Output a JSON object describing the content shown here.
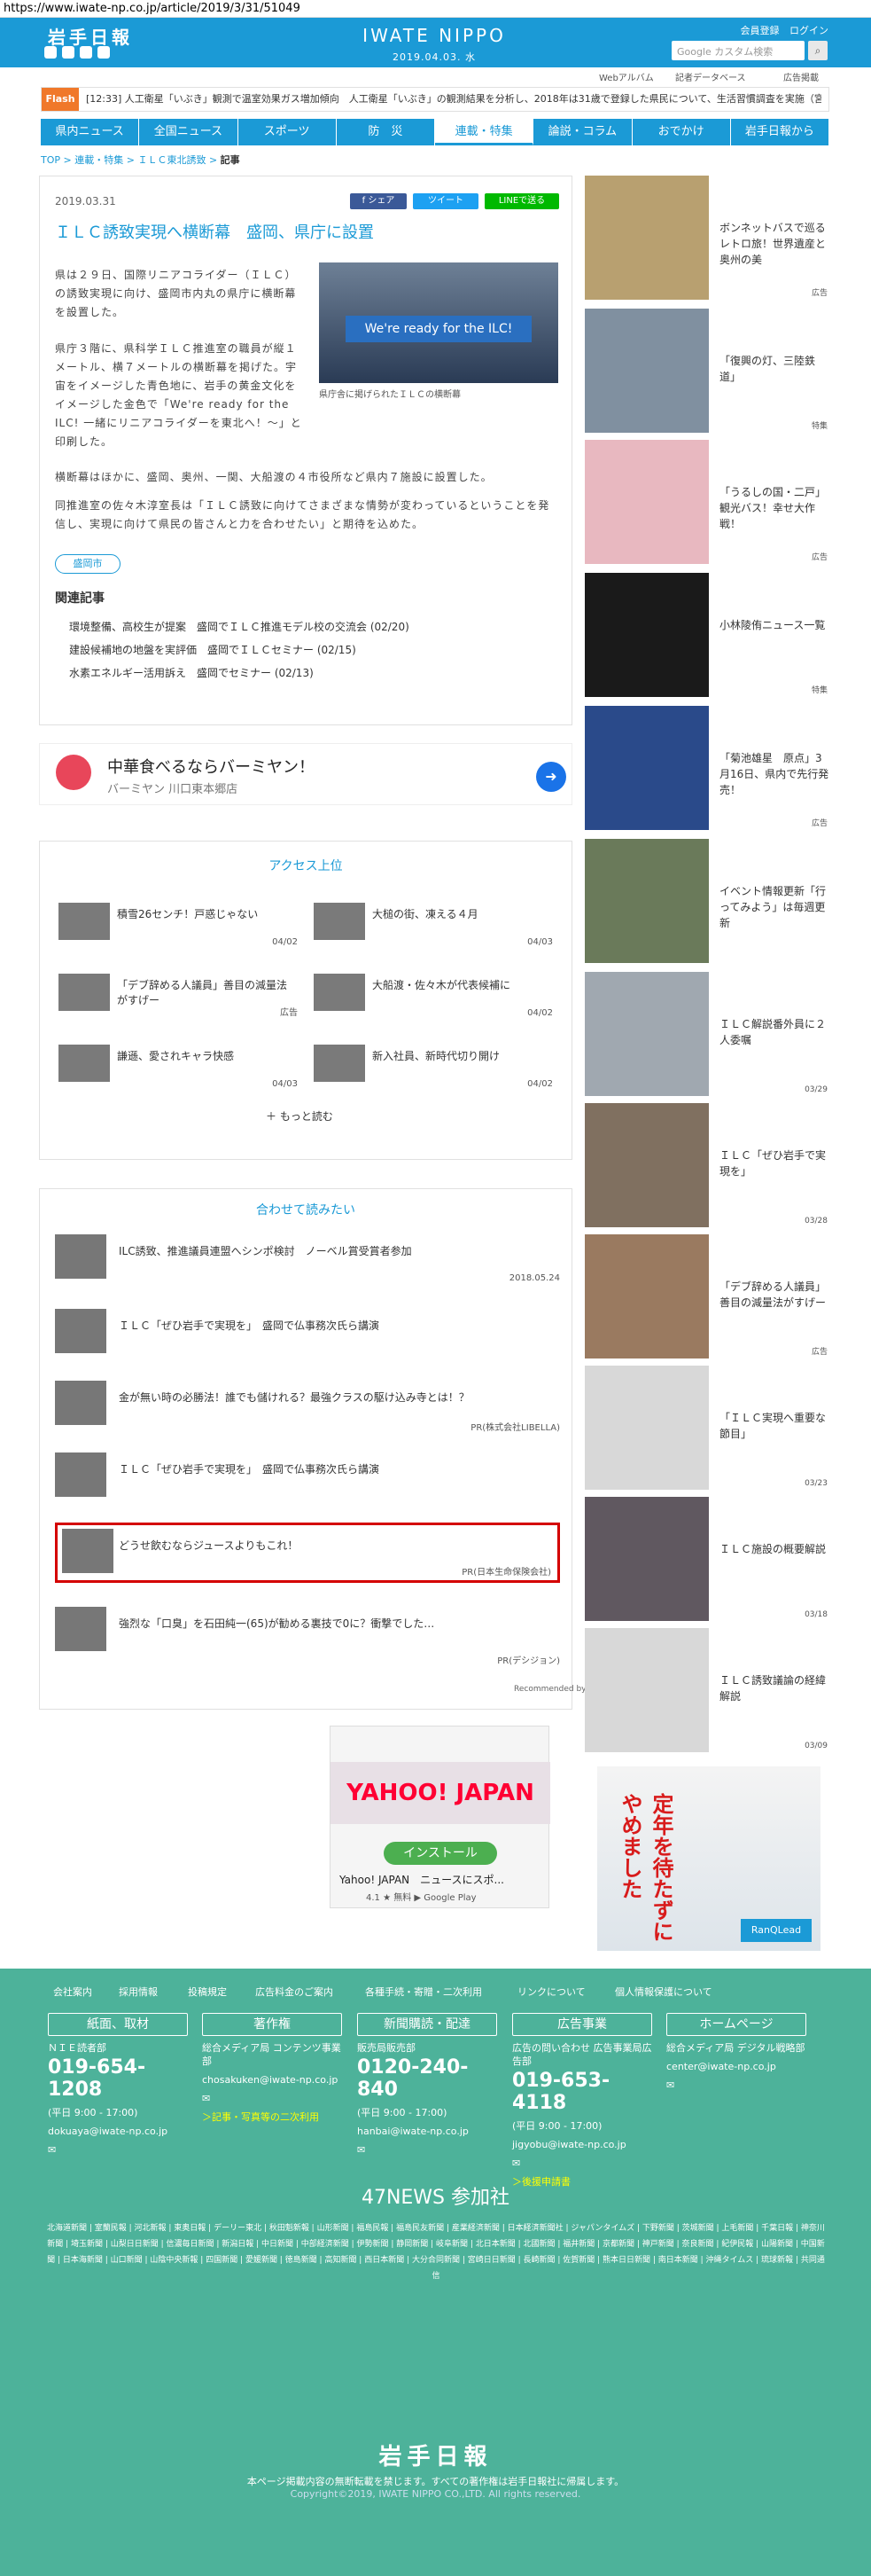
{
  "url": "https://www.iwate-np.co.jp/article/2019/3/31/51049",
  "header": {
    "logo": "岩手日報",
    "brand": "IWATE NIPPO",
    "date": "2019.04.03. 水",
    "member": "会員登録",
    "login": "ログイン",
    "search_placeholder": "Google カスタム検索"
  },
  "subnav": {
    "web_album": "Webアルバム",
    "archive": "記者データベース",
    "ads": "広告掲載"
  },
  "flash": {
    "label": "Flash",
    "text": "[12:33] 人工衛星「いぶき」観測で温室効果ガス増加傾向　人工衛星「いぶき」の観測結果を分析し、2018年は31歳で登録した県民について、生活習慣調査を実施（宮城）"
  },
  "nav": [
    "県内ニュース",
    "全国ニュース",
    "スポーツ",
    "防　災",
    "連載・特集",
    "論説・コラム",
    "おでかけ",
    "岩手日報から"
  ],
  "breadcrumb": {
    "top": "TOP",
    "sep1": " > ",
    "c1": "連載・特集",
    "sep2": " > ",
    "c2": "ＩＬＣ東北誘致",
    "sep3": " > ",
    "current": "記事"
  },
  "article": {
    "date": "2019.03.31",
    "share_fb": "f シェア",
    "share_tw": "ツイート",
    "share_line": "LINEで送る",
    "title": "ＩＬＣ誘致実現へ横断幕　盛岡、県庁に設置",
    "photo_caption": "県庁舎に掲げられたＩＬＣの横断幕",
    "p1": "県は２９日、国際リニアコライダー（ＩＬＣ）の誘致実現に向け、盛岡市内丸の県庁に横断幕を設置した。",
    "p2": "県庁３階に、県科学ＩＬＣ推進室の職員が縦１メートル、横７メートルの横断幕を掲げた。宇宙をイメージした青色地に、岩手の黄金文化をイメージした金色で「We're ready for the ILC! 一緒にリニアコライダーを東北へ！～」と印刷した。",
    "p3": "横断幕はほかに、盛岡、奥州、一関、大船渡の４市役所など県内７施設に設置した。",
    "p4": "同推進室の佐々木淳室長は「ＩＬＣ誘致に向けてさまざまな情勢が変わっているということを発信し、実現に向けて県民の皆さんと力を合わせたい」と期待を込めた。",
    "tag": "盛岡市",
    "related_heading": "関連記事",
    "related": [
      "環境整備、高校生が提案　盛岡でＩＬＣ推進モデル校の交流会 (02/20)",
      "建設候補地の地盤を実評価　盛岡でＩＬＣセミナー (02/15)",
      "水素エネルギー活用訴え　盛岡でセミナー (02/13)"
    ]
  },
  "ad1": {
    "title": "中華食べるならバーミヤン！",
    "sub": "バーミヤン 川口東本郷店"
  },
  "ranking": {
    "heading": "アクセス上位",
    "more": "もっと読む",
    "items": [
      {
        "title": "積雪26センチ！戸惑じゃない",
        "date": "04/02"
      },
      {
        "title": "大槌の街、凍える４月",
        "date": "04/03"
      },
      {
        "title": "「デブ辞める人議員」善目の減量法がすげー",
        "date": "広告"
      },
      {
        "title": "大船渡・佐々木が代表候補に",
        "date": "04/02"
      },
      {
        "title": "謙遜、愛されキャラ快感",
        "date": "04/03"
      },
      {
        "title": "新入社員、新時代切り開け",
        "date": "04/02"
      }
    ]
  },
  "recommend": {
    "heading": "合わせて読みたい",
    "credit": "Recommended by",
    "items": [
      {
        "title": "ILC誘致、推進議員連盟へシンポ検討　ノーベル賞受賞者参加",
        "date": "2018.05.24"
      },
      {
        "title": "ＩＬＣ「ぜひ岩手で実現を」　盛岡で仏事務次氏ら講演",
        "date": ""
      },
      {
        "title": "金が無い時の必勝法！誰でも儲けれる？最強クラスの駆け込み寺とは！？",
        "date": "PR(株式会社LIBELLA)"
      },
      {
        "title": "ＩＬＣ「ぜひ岩手で実現を」　盛岡で仏事務次氏ら講演",
        "date": ""
      },
      {
        "title": "どうせ飲むならジュースよりもこれ！",
        "date": "PR(日本生命保険会社)"
      },
      {
        "title": "強烈な「口臭」を石田純一(65)が勧める裏技で0に？衝撃でした…",
        "date": "PR(デシジョン)"
      }
    ]
  },
  "ad2": {
    "logo": "YAHOO! JAPAN",
    "install": "インストール",
    "name": "Yahoo! JAPAN　ニュースにスポ...",
    "rating": "4.1 ★ 無料 ▶ Google Play"
  },
  "sidebar": [
    {
      "title": "ボンネットバスで巡るレトロ旅！世界遺産と奥州の美",
      "date": "広告"
    },
    {
      "title": "「復興の灯、三陸鉄道」",
      "date": "特集"
    },
    {
      "title": "「うるしの国・二戸」観光バス！幸せ大作戦！",
      "date": "広告"
    },
    {
      "title": "小林陵侑ニュース一覧",
      "date": "特集"
    },
    {
      "title": "「菊池雄星　原点」3月16日、県内で先行発売！",
      "date": "広告"
    },
    {
      "title": "イベント情報更新「行ってみよう」は毎週更新",
      "date": ""
    },
    {
      "title": "ＩＬＣ解説番外員に２人委嘱",
      "date": "03/29"
    },
    {
      "title": "ＩＬＣ「ぜひ岩手で実現を」",
      "date": "03/28"
    },
    {
      "title": "「デブ辞める人議員」善目の減量法がすげー",
      "date": "広告"
    },
    {
      "title": "「ＩＬＣ実現へ重要な節目」",
      "date": "03/23"
    },
    {
      "title": "ＩＬＣ施設の概要解説",
      "date": "03/18"
    },
    {
      "title": "ＩＬＣ誘致議論の経緯解説",
      "date": "03/09"
    }
  ],
  "ad3": {
    "copy": "定年を待たずにやめました",
    "logo": "RanQLead"
  },
  "footer": {
    "links": [
      "会社案内",
      "採用情報",
      "投稿規定",
      "広告料金のご案内",
      "各種手続・寄贈・二次利用",
      "リンクについて",
      "個人情報保護について"
    ],
    "cols": [
      {
        "h": "紙面、取材",
        "s": "ＮＩＥ読者部",
        "ph": "019-654-1208",
        "y": "(平日 9:00 - 17:00)",
        "m": "dokuaya@iwate-np.co.jp"
      },
      {
        "h": "著作権",
        "s": "総合メディア局 コンテンツ事業部",
        "ph": "",
        "y": "",
        "m": "chosakuken@iwate-np.co.jp",
        "x": "＞記事・写真等の二次利用"
      },
      {
        "h": "新聞購読・配達",
        "s": "販売局販売部",
        "ph": "0120-240-840",
        "y": "(平日 9:00 - 17:00)",
        "m": "hanbai@iwate-np.co.jp"
      },
      {
        "h": "広告事業",
        "s": "広告の問い合わせ 広告事業局広告部",
        "ph": "019-653-4118",
        "y": "(平日 9:00 - 17:00)",
        "m": "jigyobu@iwate-np.co.jp",
        "x": "＞後援申請書"
      },
      {
        "h": "ホームページ",
        "s": "総合メディア局 デジタル戦略部",
        "ph": "",
        "y": "",
        "m": "center@iwate-np.co.jp"
      }
    ],
    "news47": "47NEWS 参加社",
    "papers": "北海道新聞 | 室蘭民報 | 河北新報 | 東奥日報 | デーリー東北 | 秋田魁新報 | 山形新聞 | 福島民報 | 福島民友新聞 | 産業経済新聞 | 日本経済新聞社 | ジャパンタイムズ | 下野新聞 | 茨城新聞 | 上毛新聞 | 千葉日報 | 神奈川新聞 | 埼玉新聞 | 山梨日日新聞 | 信濃毎日新聞 | 新潟日報 | 中日新聞 | 中部経済新聞 | 伊勢新聞 | 静岡新聞 | 岐阜新聞 | 北日本新聞 | 北國新聞 | 福井新聞 | 京都新聞 | 神戸新聞 | 奈良新聞 | 紀伊民報 | 山陽新聞 | 中国新聞 | 日本海新聞 | 山口新聞 | 山陰中央新報 | 四国新聞 | 愛媛新聞 | 徳島新聞 | 高知新聞 | 西日本新聞 | 大分合同新聞 | 宮崎日日新聞 | 長崎新聞 | 佐賀新聞 | 熊本日日新聞 | 南日本新聞 | 沖縄タイムス | 琉球新報 | 共同通信",
    "logo": "岩手日報",
    "copy1": "本ページ掲載内容の無断転載を禁じます。すべての著作権は岩手日報社に帰属します。",
    "copy2": "Copyright©2019, IWATE NIPPO CO.,LTD. All rights reserved."
  }
}
